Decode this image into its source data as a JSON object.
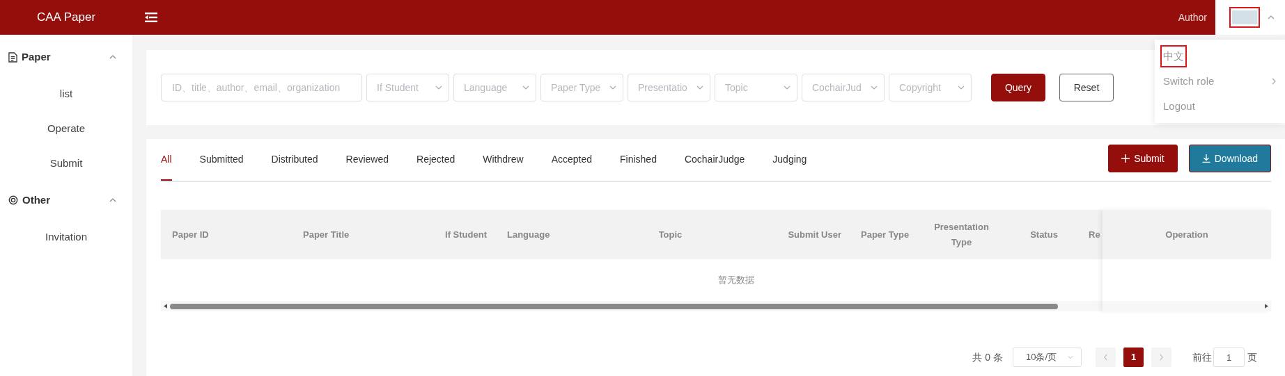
{
  "header": {
    "brand": "CAA Paper",
    "role": "Author",
    "avatar": {
      "annotated": true
    }
  },
  "user_menu": [
    {
      "label": "中文",
      "kind": "plain",
      "annotated": true
    },
    {
      "label": "Switch role",
      "kind": "submenu",
      "annotated": false
    },
    {
      "label": "Logout",
      "kind": "plain",
      "annotated": false
    }
  ],
  "sidebar": [
    {
      "title": "Paper",
      "kind": "document",
      "expanded": true,
      "children": [
        {
          "label": "list"
        },
        {
          "label": "Operate"
        },
        {
          "label": "Submit"
        }
      ]
    },
    {
      "title": "Other",
      "kind": "at",
      "expanded": true,
      "children": [
        {
          "label": "Invitation"
        }
      ]
    }
  ],
  "filters": {
    "search": {
      "placeholder": "ID、title、author、email、organization"
    },
    "selects": [
      {
        "placeholder": "If Student"
      },
      {
        "placeholder": "Language"
      },
      {
        "placeholder": "Paper Type"
      },
      {
        "placeholder": "Presentatio"
      },
      {
        "placeholder": "Topic"
      },
      {
        "placeholder": "CochairJud"
      },
      {
        "placeholder": "Copyright"
      }
    ],
    "buttons": [
      {
        "label": "Query",
        "kind": "primary"
      },
      {
        "label": "Reset",
        "kind": "plain"
      }
    ]
  },
  "tabs": [
    {
      "label": "All",
      "selected": true
    },
    {
      "label": "Submitted",
      "selected": false
    },
    {
      "label": "Distributed",
      "selected": false
    },
    {
      "label": "Reviewed",
      "selected": false
    },
    {
      "label": "Rejected",
      "selected": false
    },
    {
      "label": "Withdrew",
      "selected": false
    },
    {
      "label": "Accepted",
      "selected": false
    },
    {
      "label": "Finished",
      "selected": false
    },
    {
      "label": "CochairJudge",
      "selected": false
    },
    {
      "label": "Judging",
      "selected": false
    }
  ],
  "actions": [
    {
      "label": "Submit",
      "kind": "add"
    },
    {
      "label": "Download",
      "kind": "download"
    }
  ],
  "table": {
    "columns": [
      "Paper ID",
      "Paper Title",
      "If Student",
      "Language",
      "Topic",
      "Submit User",
      "Paper Type",
      "Presentation Type",
      "Status",
      "Re"
    ],
    "fixed_column": "Operation",
    "empty_text": "暂无数据"
  },
  "pagination": {
    "total": "共 0 条",
    "page_size": "10条/页",
    "pages": [
      {
        "label": "1",
        "selected": true
      }
    ],
    "goto_label": "前往",
    "goto_value": "1",
    "goto_suffix": "页"
  }
}
